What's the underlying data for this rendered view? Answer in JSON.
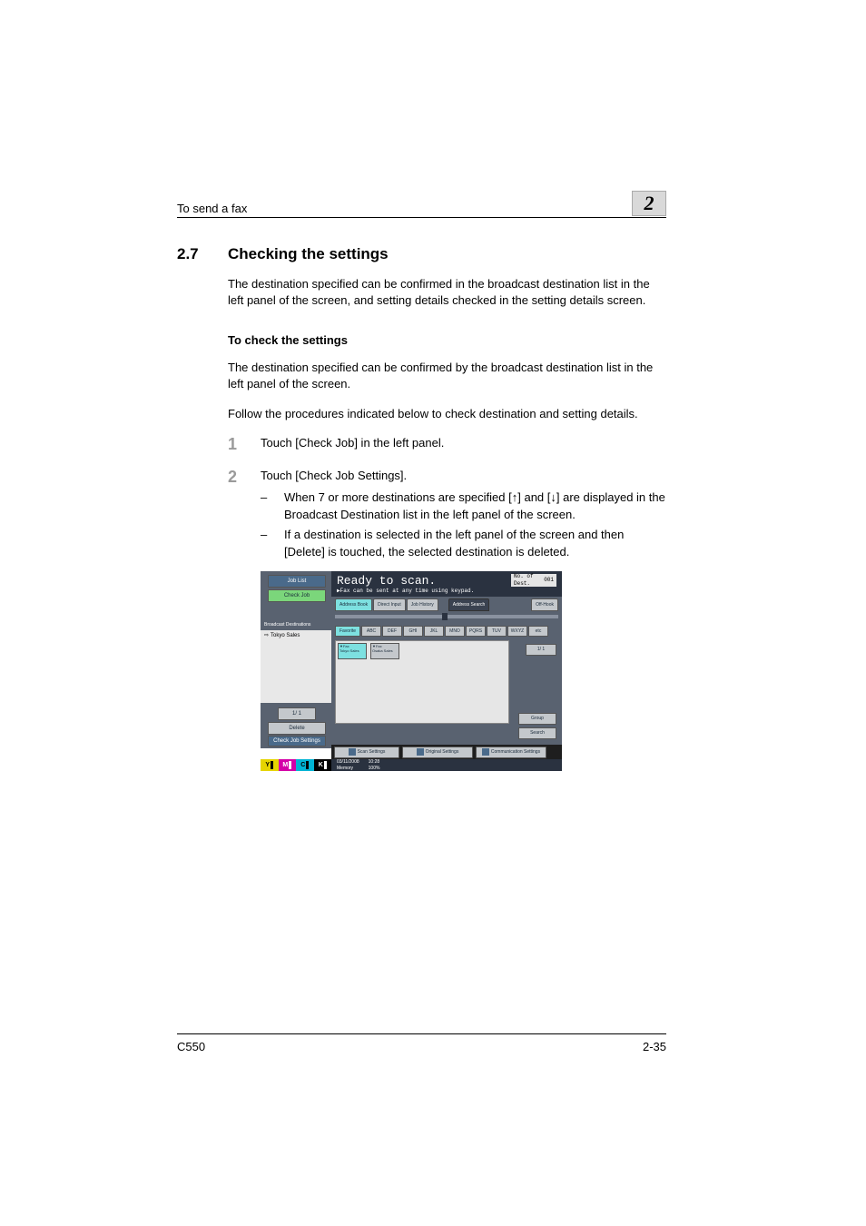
{
  "header": {
    "left": "To send a fax",
    "chapter": "2"
  },
  "section": {
    "number": "2.7",
    "title": "Checking the settings"
  },
  "intro": "The destination specified can be confirmed in the broadcast destination list in the left panel of the screen, and setting details checked in the setting details screen.",
  "sub": {
    "heading": "To check the settings",
    "p1": "The destination specified can be confirmed by the broadcast destination list in the left panel of the screen.",
    "p2": "Follow the procedures indicated below to check destination and setting details."
  },
  "steps": {
    "s1": {
      "n": "1",
      "t": "Touch [Check Job] in the left panel."
    },
    "s2": {
      "n": "2",
      "t": "Touch [Check Job Settings].",
      "b1": "When 7 or more destinations are specified [↑] and [↓] are displayed in the Broadcast Destination list in the left panel of the screen.",
      "b2": "If a destination is selected in the left panel of the screen and then [Delete] is touched, the selected destination is deleted."
    }
  },
  "shot": {
    "ready": "Ready to scan.",
    "readysub": "▶Fax can be sent at any time using keypad.",
    "dest_no_label": "No. of Dest.",
    "dest_no_val": "001",
    "left": {
      "job_list": "Job List",
      "check_job": "Check Job",
      "broadcast": "Broadcast Destinations",
      "row1": "Tokyo Sales",
      "pager": "1/  1",
      "delete": "Delete",
      "check_settings": "Check Job Settings"
    },
    "tabs": {
      "address_book": "Address Book",
      "direct_input": "Direct Input",
      "job_history": "Job History",
      "addr_search": "Address Search",
      "off_hook": "Off-Hook"
    },
    "alphas": {
      "fav": "Favorite",
      "a": "ABC",
      "d": "DEF",
      "g": "GHI",
      "j": "JKL",
      "m": "MNO",
      "p": "PQRS",
      "t": "TUV",
      "w": "WXYZ",
      "e": "etc"
    },
    "contacts": {
      "c1_type": "▼Fax",
      "c1_name": "Tokyo Sales",
      "c2_type": "▼Fax",
      "c2_name": "Osaka Sales"
    },
    "right": {
      "pager": "1/  1",
      "group": "Group",
      "search": "Search"
    },
    "bottom": {
      "scan": "Scan Settings",
      "orig": "Original Settings",
      "comm": "Communication Settings"
    },
    "status": {
      "date": "03/11/2008",
      "time": "10:28",
      "mem_l": "Memory",
      "mem_v": "100%"
    },
    "toner": {
      "y": "Y",
      "m": "M",
      "c": "C",
      "k": "K"
    }
  },
  "footer": {
    "left": "C550",
    "right": "2-35"
  }
}
